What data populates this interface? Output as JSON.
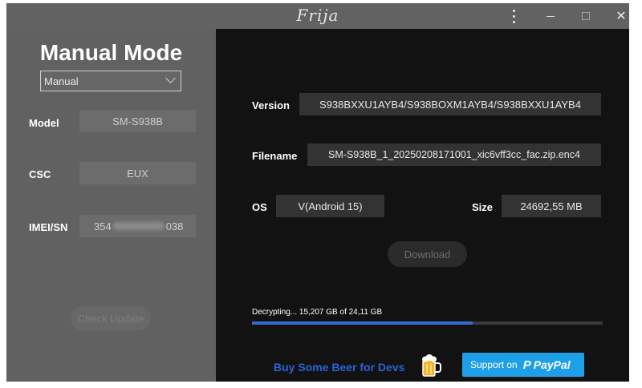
{
  "window": {
    "title": "Frija",
    "close_glyph": "✕"
  },
  "left": {
    "heading": "Manual Mode",
    "mode_select": {
      "value": "Manual"
    },
    "model": {
      "label": "Model",
      "value": "SM-S938B"
    },
    "csc": {
      "label": "CSC",
      "value": "EUX"
    },
    "imei": {
      "label": "IMEI/SN",
      "value_prefix": "354",
      "value_suffix": "038"
    },
    "check_button": "Check Update"
  },
  "right": {
    "version": {
      "label": "Version",
      "value": "S938BXXU1AYB4/S938BOXM1AYB4/S938BXXU1AYB4"
    },
    "filename": {
      "label": "Filename",
      "value": "SM-S938B_1_20250208171001_xic6vff3cc_fac.zip.enc4"
    },
    "os": {
      "label": "OS",
      "value": "V(Android 15)"
    },
    "size": {
      "label": "Size",
      "value": "24692,55 MB"
    },
    "download_button": "Download",
    "status": "Decrypting... 15,207 GB of 24,11 GB",
    "progress": 0.63,
    "beer_text": "Buy Some Beer for Devs",
    "paypal": {
      "prefix": "Support on",
      "mark": "P",
      "word": "PayPal"
    }
  },
  "colors": {
    "accent": "#2f6bd1",
    "paypal": "#1ea0e8",
    "beer_text": "#2a62d6"
  },
  "icons": {
    "menu": "more-vertical-icon",
    "minimize": "minimize-icon",
    "maximize": "maximize-icon",
    "close": "close-icon",
    "dropdown": "chevron-down-icon",
    "beer": "beer-mug-icon"
  }
}
